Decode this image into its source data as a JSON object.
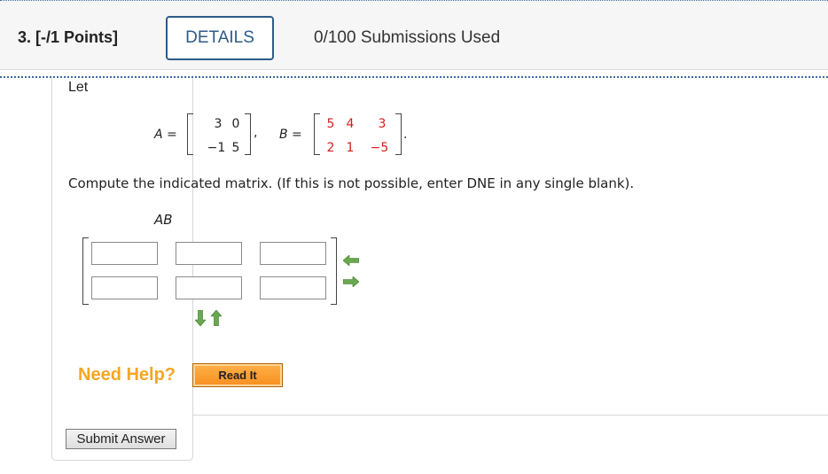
{
  "question": {
    "number_label": "3. [-/1 Points]",
    "details_label": "DETAILS",
    "submissions_text": "0/100 Submissions Used"
  },
  "problem": {
    "intro": "Let",
    "matrix_a": {
      "label": "A =",
      "rows": [
        [
          "3",
          "0"
        ],
        [
          "−1",
          "5"
        ]
      ],
      "trailing": ","
    },
    "matrix_b": {
      "label": "B =",
      "rows": [
        [
          "5",
          "4",
          "3"
        ],
        [
          "2",
          "1",
          "−5"
        ]
      ],
      "trailing": "."
    },
    "instruction": "Compute the indicated matrix. (If this is not possible, enter DNE in any single blank).",
    "target_label": "AB"
  },
  "answer_grid": {
    "rows": [
      [
        "",
        "",
        ""
      ],
      [
        "",
        "",
        ""
      ]
    ]
  },
  "icons": {
    "remove_column": "arrow-left-icon",
    "add_column": "arrow-right-icon",
    "add_row": "arrow-down-icon",
    "remove_row": "arrow-up-icon",
    "arrow_color": "#6aa84f"
  },
  "help": {
    "need_help_label": "Need Help?",
    "read_it_label": "Read It"
  },
  "submit_label": "Submit Answer",
  "colors": {
    "accent": "#2d5c8a",
    "help_orange": "#f5a623",
    "matrix_b_values": "#d21e1e"
  }
}
